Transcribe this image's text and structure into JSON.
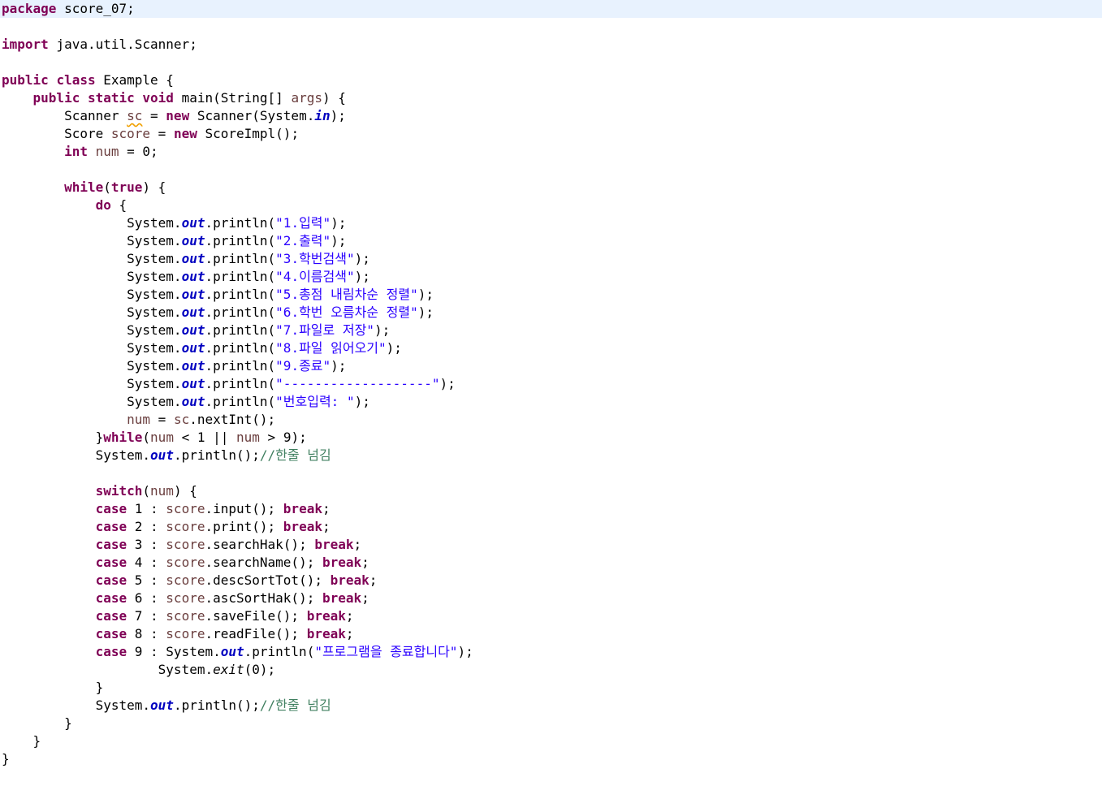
{
  "editor": {
    "language": "java",
    "current_line": 0,
    "colors": {
      "keyword": "#7f0055",
      "string": "#2a00ff",
      "static_field": "#0000c0",
      "local_variable": "#6a3e3e",
      "comment": "#3f7f5f",
      "current_line_highlight": "#e8f2fe",
      "warning_underline": "#f0a000"
    },
    "lines": [
      [
        [
          "kw",
          "package"
        ],
        [
          "pl",
          " score_07;"
        ]
      ],
      [],
      [
        [
          "kw",
          "import"
        ],
        [
          "pl",
          " java.util.Scanner;"
        ]
      ],
      [],
      [
        [
          "kw",
          "public"
        ],
        [
          "pl",
          " "
        ],
        [
          "kw",
          "class"
        ],
        [
          "pl",
          " Example {"
        ]
      ],
      [
        [
          "pl",
          "    "
        ],
        [
          "kw",
          "public"
        ],
        [
          "pl",
          " "
        ],
        [
          "kw",
          "static"
        ],
        [
          "pl",
          " "
        ],
        [
          "kw",
          "void"
        ],
        [
          "pl",
          " main(String[] "
        ],
        [
          "var",
          "args"
        ],
        [
          "pl",
          ") {"
        ]
      ],
      [
        [
          "pl",
          "        Scanner "
        ],
        [
          "warn",
          "sc"
        ],
        [
          "pl",
          " = "
        ],
        [
          "kw",
          "new"
        ],
        [
          "pl",
          " Scanner(System."
        ],
        [
          "fld",
          "in"
        ],
        [
          "pl",
          ");"
        ]
      ],
      [
        [
          "pl",
          "        Score "
        ],
        [
          "var",
          "score"
        ],
        [
          "pl",
          " = "
        ],
        [
          "kw",
          "new"
        ],
        [
          "pl",
          " ScoreImpl();"
        ]
      ],
      [
        [
          "pl",
          "        "
        ],
        [
          "kw",
          "int"
        ],
        [
          "pl",
          " "
        ],
        [
          "var",
          "num"
        ],
        [
          "pl",
          " = 0;"
        ]
      ],
      [],
      [
        [
          "pl",
          "        "
        ],
        [
          "kw",
          "while"
        ],
        [
          "pl",
          "("
        ],
        [
          "kw",
          "true"
        ],
        [
          "pl",
          ") {"
        ]
      ],
      [
        [
          "pl",
          "            "
        ],
        [
          "kw",
          "do"
        ],
        [
          "pl",
          " {"
        ]
      ],
      [
        [
          "pl",
          "                System."
        ],
        [
          "fld",
          "out"
        ],
        [
          "pl",
          ".println("
        ],
        [
          "str",
          "\"1.입력\""
        ],
        [
          "pl",
          ");"
        ]
      ],
      [
        [
          "pl",
          "                System."
        ],
        [
          "fld",
          "out"
        ],
        [
          "pl",
          ".println("
        ],
        [
          "str",
          "\"2.출력\""
        ],
        [
          "pl",
          ");"
        ]
      ],
      [
        [
          "pl",
          "                System."
        ],
        [
          "fld",
          "out"
        ],
        [
          "pl",
          ".println("
        ],
        [
          "str",
          "\"3.학번검색\""
        ],
        [
          "pl",
          ");"
        ]
      ],
      [
        [
          "pl",
          "                System."
        ],
        [
          "fld",
          "out"
        ],
        [
          "pl",
          ".println("
        ],
        [
          "str",
          "\"4.이름검색\""
        ],
        [
          "pl",
          ");"
        ]
      ],
      [
        [
          "pl",
          "                System."
        ],
        [
          "fld",
          "out"
        ],
        [
          "pl",
          ".println("
        ],
        [
          "str",
          "\"5.총점 내림차순 정렬\""
        ],
        [
          "pl",
          ");"
        ]
      ],
      [
        [
          "pl",
          "                System."
        ],
        [
          "fld",
          "out"
        ],
        [
          "pl",
          ".println("
        ],
        [
          "str",
          "\"6.학번 오름차순 정렬\""
        ],
        [
          "pl",
          ");"
        ]
      ],
      [
        [
          "pl",
          "                System."
        ],
        [
          "fld",
          "out"
        ],
        [
          "pl",
          ".println("
        ],
        [
          "str",
          "\"7.파일로 저장\""
        ],
        [
          "pl",
          ");"
        ]
      ],
      [
        [
          "pl",
          "                System."
        ],
        [
          "fld",
          "out"
        ],
        [
          "pl",
          ".println("
        ],
        [
          "str",
          "\"8.파일 읽어오기\""
        ],
        [
          "pl",
          ");"
        ]
      ],
      [
        [
          "pl",
          "                System."
        ],
        [
          "fld",
          "out"
        ],
        [
          "pl",
          ".println("
        ],
        [
          "str",
          "\"9.종료\""
        ],
        [
          "pl",
          ");"
        ]
      ],
      [
        [
          "pl",
          "                System."
        ],
        [
          "fld",
          "out"
        ],
        [
          "pl",
          ".println("
        ],
        [
          "str",
          "\"-------------------\""
        ],
        [
          "pl",
          ");"
        ]
      ],
      [
        [
          "pl",
          "                System."
        ],
        [
          "fld",
          "out"
        ],
        [
          "pl",
          ".println("
        ],
        [
          "str",
          "\"번호입력: \""
        ],
        [
          "pl",
          ");"
        ]
      ],
      [
        [
          "pl",
          "                "
        ],
        [
          "var",
          "num"
        ],
        [
          "pl",
          " = "
        ],
        [
          "var",
          "sc"
        ],
        [
          "pl",
          ".nextInt();"
        ]
      ],
      [
        [
          "pl",
          "            }"
        ],
        [
          "kw",
          "while"
        ],
        [
          "pl",
          "("
        ],
        [
          "var",
          "num"
        ],
        [
          "pl",
          " < 1 || "
        ],
        [
          "var",
          "num"
        ],
        [
          "pl",
          " > 9);"
        ]
      ],
      [
        [
          "pl",
          "            System."
        ],
        [
          "fld",
          "out"
        ],
        [
          "pl",
          ".println();"
        ],
        [
          "cm",
          "//한줄 넘김"
        ]
      ],
      [],
      [
        [
          "pl",
          "            "
        ],
        [
          "kw",
          "switch"
        ],
        [
          "pl",
          "("
        ],
        [
          "var",
          "num"
        ],
        [
          "pl",
          ") {"
        ]
      ],
      [
        [
          "pl",
          "            "
        ],
        [
          "kw",
          "case"
        ],
        [
          "pl",
          " 1 : "
        ],
        [
          "var",
          "score"
        ],
        [
          "pl",
          ".input(); "
        ],
        [
          "kw",
          "break"
        ],
        [
          "pl",
          ";"
        ]
      ],
      [
        [
          "pl",
          "            "
        ],
        [
          "kw",
          "case"
        ],
        [
          "pl",
          " 2 : "
        ],
        [
          "var",
          "score"
        ],
        [
          "pl",
          ".print(); "
        ],
        [
          "kw",
          "break"
        ],
        [
          "pl",
          ";"
        ]
      ],
      [
        [
          "pl",
          "            "
        ],
        [
          "kw",
          "case"
        ],
        [
          "pl",
          " 3 : "
        ],
        [
          "var",
          "score"
        ],
        [
          "pl",
          ".searchHak(); "
        ],
        [
          "kw",
          "break"
        ],
        [
          "pl",
          ";"
        ]
      ],
      [
        [
          "pl",
          "            "
        ],
        [
          "kw",
          "case"
        ],
        [
          "pl",
          " 4 : "
        ],
        [
          "var",
          "score"
        ],
        [
          "pl",
          ".searchName(); "
        ],
        [
          "kw",
          "break"
        ],
        [
          "pl",
          ";"
        ]
      ],
      [
        [
          "pl",
          "            "
        ],
        [
          "kw",
          "case"
        ],
        [
          "pl",
          " 5 : "
        ],
        [
          "var",
          "score"
        ],
        [
          "pl",
          ".descSortTot(); "
        ],
        [
          "kw",
          "break"
        ],
        [
          "pl",
          ";"
        ]
      ],
      [
        [
          "pl",
          "            "
        ],
        [
          "kw",
          "case"
        ],
        [
          "pl",
          " 6 : "
        ],
        [
          "var",
          "score"
        ],
        [
          "pl",
          ".ascSortHak(); "
        ],
        [
          "kw",
          "break"
        ],
        [
          "pl",
          ";"
        ]
      ],
      [
        [
          "pl",
          "            "
        ],
        [
          "kw",
          "case"
        ],
        [
          "pl",
          " 7 : "
        ],
        [
          "var",
          "score"
        ],
        [
          "pl",
          ".saveFile(); "
        ],
        [
          "kw",
          "break"
        ],
        [
          "pl",
          ";"
        ]
      ],
      [
        [
          "pl",
          "            "
        ],
        [
          "kw",
          "case"
        ],
        [
          "pl",
          " 8 : "
        ],
        [
          "var",
          "score"
        ],
        [
          "pl",
          ".readFile(); "
        ],
        [
          "kw",
          "break"
        ],
        [
          "pl",
          ";"
        ]
      ],
      [
        [
          "pl",
          "            "
        ],
        [
          "kw",
          "case"
        ],
        [
          "pl",
          " 9 : System."
        ],
        [
          "fld",
          "out"
        ],
        [
          "pl",
          ".println("
        ],
        [
          "str",
          "\"프로그램을 종료합니다\""
        ],
        [
          "pl",
          ");"
        ]
      ],
      [
        [
          "pl",
          "                    System."
        ],
        [
          "it",
          "exit"
        ],
        [
          "pl",
          "(0);"
        ]
      ],
      [
        [
          "pl",
          "            }"
        ]
      ],
      [
        [
          "pl",
          "            System."
        ],
        [
          "fld",
          "out"
        ],
        [
          "pl",
          ".println();"
        ],
        [
          "cm",
          "//한줄 넘김"
        ]
      ],
      [
        [
          "pl",
          "        }"
        ]
      ],
      [
        [
          "pl",
          "    }"
        ]
      ],
      [
        [
          "pl",
          "}"
        ]
      ]
    ]
  }
}
